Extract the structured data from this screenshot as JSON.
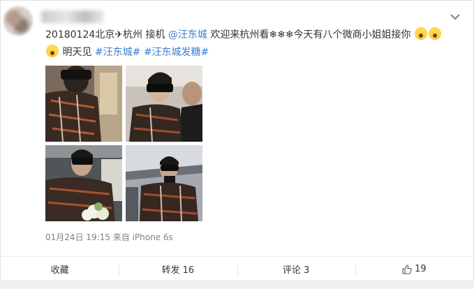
{
  "post": {
    "text_line1": "20180124北京✈杭州 接机",
    "mention": "@汪东城",
    "text_line1_rest": " 欢迎来杭州看❄❄❄今天有八个微商小姐姐接你",
    "text_line2": "明天见",
    "hashtags": [
      "#汪东城#",
      "#汪东城发糖#"
    ],
    "meta": "01月24日 19:15 来自 iPhone 6s"
  },
  "photos": [
    {
      "icon": "photo-airport-sunglasses"
    },
    {
      "icon": "photo-crowd"
    },
    {
      "icon": "photo-flowers"
    },
    {
      "icon": "photo-terminal"
    }
  ],
  "actions": {
    "favorite": "收藏",
    "repost": "转发 16",
    "comment": "评论 3",
    "like": "19"
  },
  "colors": {
    "link": "#3a7fd0",
    "meta": "#808080",
    "text": "#333333"
  }
}
